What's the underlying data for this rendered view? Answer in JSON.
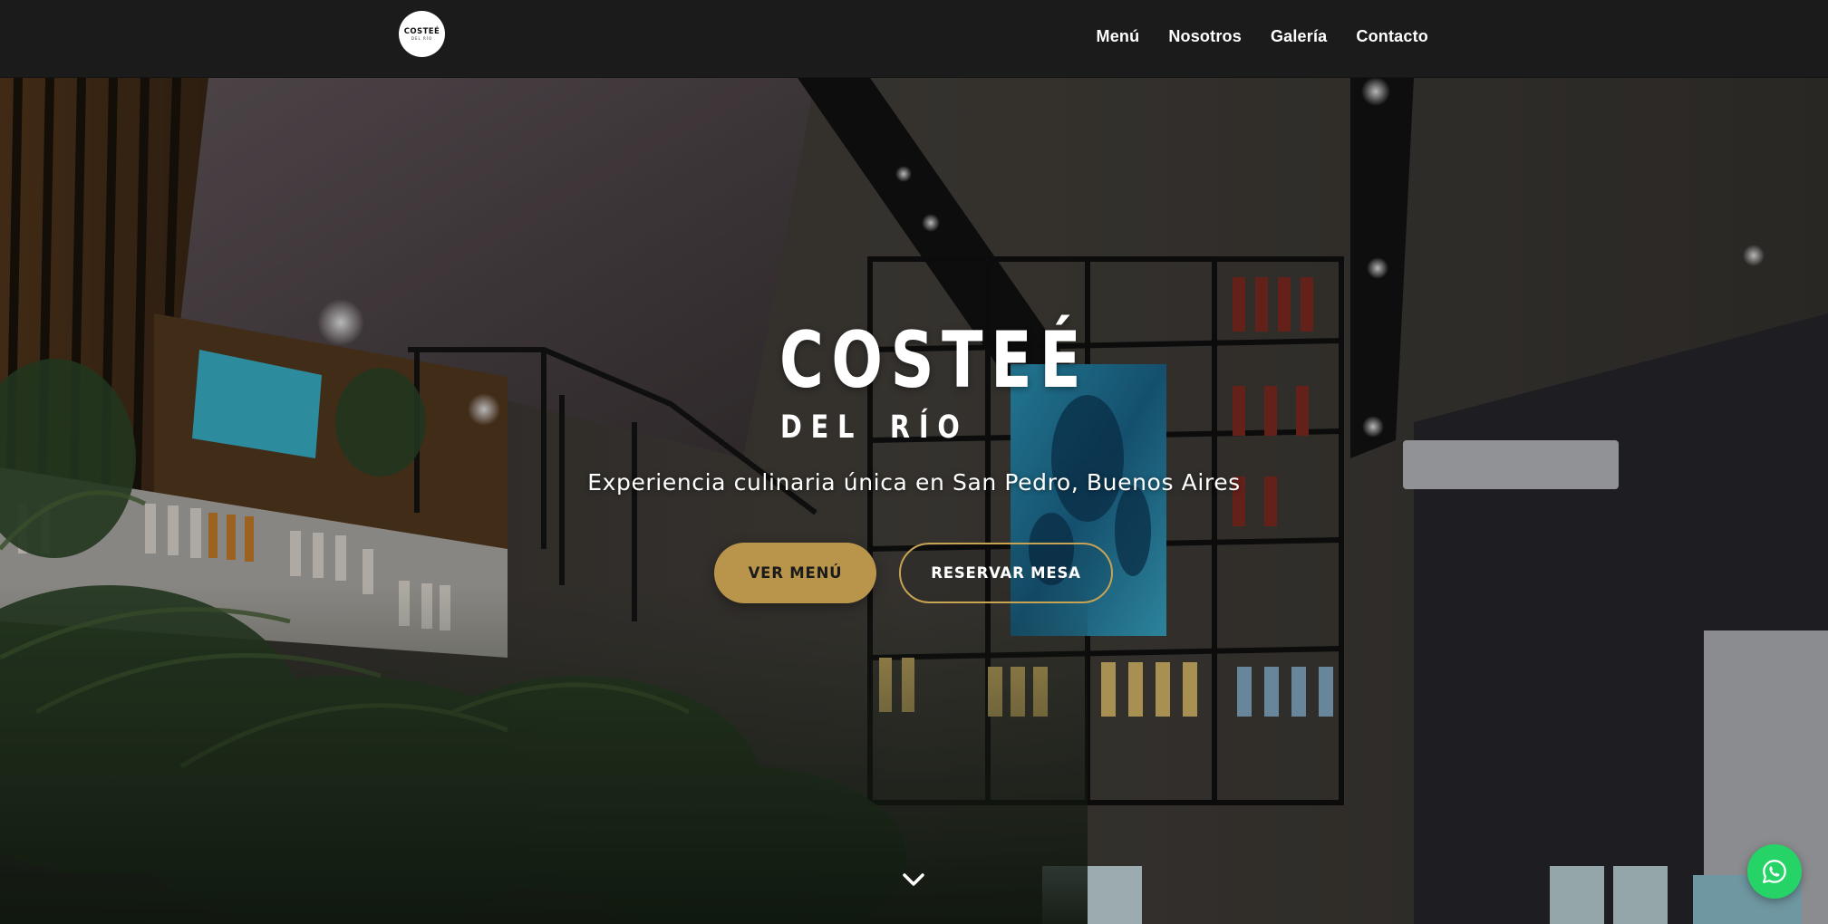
{
  "nav": {
    "logo": {
      "main": "COSTEÉ",
      "sub": "DEL RÍO"
    },
    "links": [
      {
        "label": "Menú"
      },
      {
        "label": "Nosotros"
      },
      {
        "label": "Galería"
      },
      {
        "label": "Contacto"
      }
    ]
  },
  "hero": {
    "title": "COSTEÉ",
    "subtitle": "DEL RÍO",
    "tagline": "Experiencia culinaria única en San Pedro, Buenos Aires",
    "primary_button": "VER MENÚ",
    "secondary_button": "RESERVAR MESA",
    "scroll_icon": "chevron-down-icon"
  },
  "floating": {
    "whatsapp_icon": "whatsapp-icon",
    "whatsapp_color": "#25d366"
  },
  "colors": {
    "accent_gold": "#b8954a",
    "navbar_bg": "#1b1b1b"
  }
}
